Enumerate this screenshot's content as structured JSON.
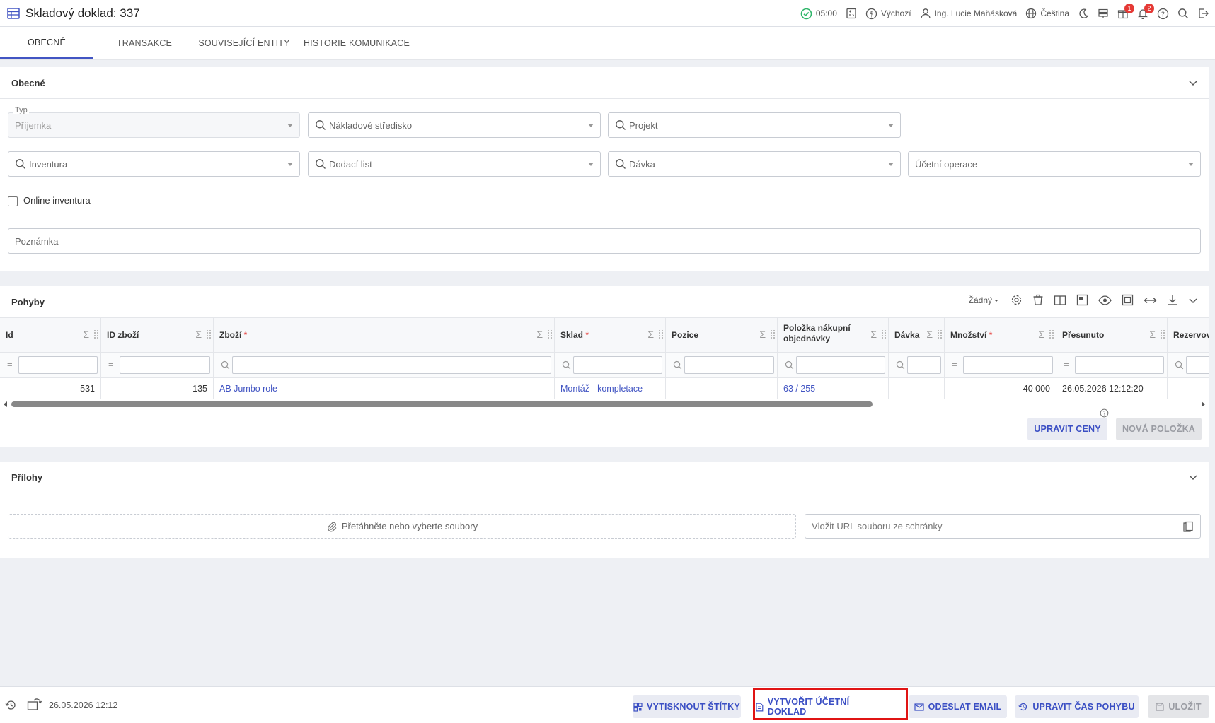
{
  "header": {
    "title": "Skladový doklad: 337",
    "timer": "05:00",
    "mode": "Výchozí",
    "user": "Ing. Lucie Maňásková",
    "language": "Čeština",
    "gift_badge": "1",
    "notifications_badge": "2"
  },
  "tabs": [
    "OBECNÉ",
    "TRANSAKCE",
    "SOUVISEJÍCÍ ENTITY",
    "HISTORIE KOMUNIKACE"
  ],
  "general": {
    "title": "Obecné",
    "type_label": "Typ",
    "type_value": "Příjemka",
    "cost_center": "Nákladové středisko",
    "project": "Projekt",
    "inventory": "Inventura",
    "delivery_note": "Dodací list",
    "batch": "Dávka",
    "accounting_operation": "Účetní operace",
    "online_inventory": "Online inventura",
    "note": "Poznámka"
  },
  "movements": {
    "title": "Pohyby",
    "view_select": "Žádný",
    "columns": [
      "Id",
      "ID zboží",
      "Zboží",
      "Sklad",
      "Pozice",
      "Položka nákupní objednávky",
      "Dávka",
      "Množství",
      "Přesunuto",
      "Rezervov"
    ],
    "row": {
      "id": "531",
      "goods_id": "135",
      "goods": "AB Jumbo role",
      "warehouse": "Montáž - kompletace",
      "position": "",
      "po_item": "63 / 255",
      "batch": "",
      "quantity": "40 000",
      "moved": "26.05.2026 12:12:20"
    },
    "edit_prices": "UPRAVIT CENY",
    "new_item": "NOVÁ POLOŽKA"
  },
  "attachments": {
    "title": "Přílohy",
    "dropzone": "Přetáhněte nebo vyberte soubory",
    "url_placeholder": "Vložit URL souboru ze schránky"
  },
  "footer": {
    "timestamp": "26.05.2026 12:12",
    "print_labels": "VYTISKNOUT ŠTÍTKY",
    "create_doc": "VYTVOŘIT ÚČETNÍ DOKLAD",
    "send_email": "ODESLAT EMAIL",
    "edit_move_time": "UPRAVIT ČAS POHYBU",
    "save": "ULOŽIT"
  },
  "colors": {
    "accent": "#4255c3",
    "highlight": "#e01414",
    "success": "#2fb66a"
  }
}
